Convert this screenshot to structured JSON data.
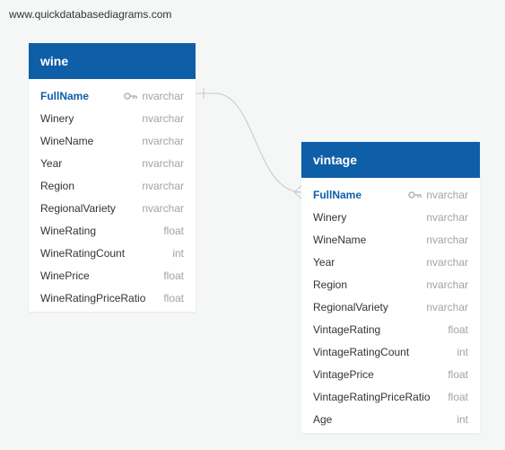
{
  "watermark": "www.quickdatabasediagrams.com",
  "tables": [
    {
      "name": "wine",
      "columns": [
        {
          "name": "FullName",
          "type": "nvarchar",
          "pk": true
        },
        {
          "name": "Winery",
          "type": "nvarchar"
        },
        {
          "name": "WineName",
          "type": "nvarchar"
        },
        {
          "name": "Year",
          "type": "nvarchar"
        },
        {
          "name": "Region",
          "type": "nvarchar"
        },
        {
          "name": "RegionalVariety",
          "type": "nvarchar"
        },
        {
          "name": "WineRating",
          "type": "float"
        },
        {
          "name": "WineRatingCount",
          "type": "int"
        },
        {
          "name": "WinePrice",
          "type": "float"
        },
        {
          "name": "WineRatingPriceRatio",
          "type": "float"
        }
      ]
    },
    {
      "name": "vintage",
      "columns": [
        {
          "name": "FullName",
          "type": "nvarchar",
          "pk": true
        },
        {
          "name": "Winery",
          "type": "nvarchar"
        },
        {
          "name": "WineName",
          "type": "nvarchar"
        },
        {
          "name": "Year",
          "type": "nvarchar"
        },
        {
          "name": "Region",
          "type": "nvarchar"
        },
        {
          "name": "RegionalVariety",
          "type": "nvarchar"
        },
        {
          "name": "VintageRating",
          "type": "float"
        },
        {
          "name": "VintageRatingCount",
          "type": "int"
        },
        {
          "name": "VintagePrice",
          "type": "float"
        },
        {
          "name": "VintageRatingPriceRatio",
          "type": "float"
        },
        {
          "name": "Age",
          "type": "int"
        }
      ]
    }
  ],
  "relationship": {
    "from": "wine.FullName",
    "to": "vintage.FullName",
    "from_end": "one",
    "to_end": "many"
  },
  "colors": {
    "header": "#0f5ea8",
    "background": "#f5f6f6",
    "type_text": "#a3a3a3",
    "key_icon": "#b5b5b5",
    "connector": "#c8c8c8"
  }
}
